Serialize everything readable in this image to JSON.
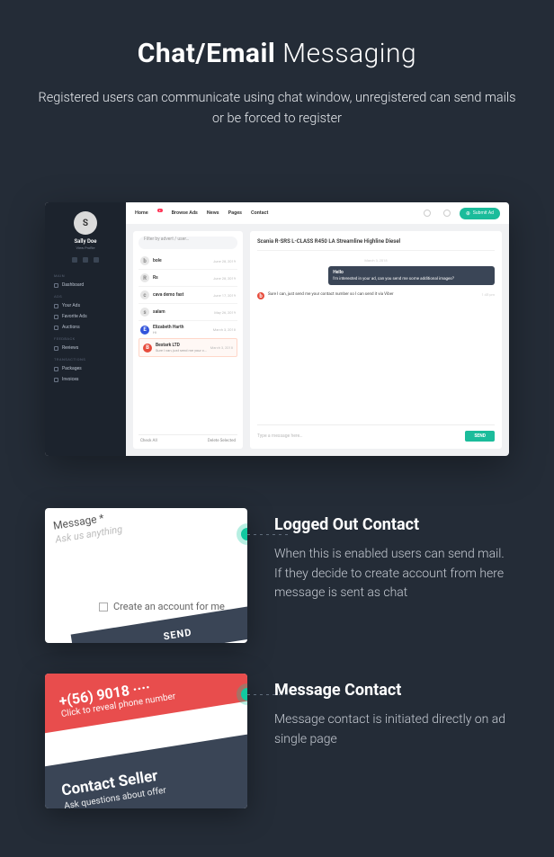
{
  "hero": {
    "title_bold": "Chat/Email",
    "title_rest": " Messaging",
    "subtitle": "Registered users can communicate using chat window, unregistered can send mails or be forced to register"
  },
  "dashboard": {
    "user": {
      "name": "Sally Doe",
      "sub": "View Profile"
    },
    "topnav": {
      "home": "Home",
      "home_badge": "●",
      "browse": "Browse Ads",
      "news": "News",
      "pages": "Pages",
      "contact": "Contact",
      "submit": "Submit Ad"
    },
    "sections": {
      "main": "MAIN",
      "ads": "ADS",
      "feedback": "FEEDBACK",
      "transactions": "TRANSACTIONS"
    },
    "nav": {
      "dashboard": "Dashboard",
      "your_ads": "Your Ads",
      "favorite_ads": "Favorite Ads",
      "auctions": "Auctions",
      "reviews": "Reviews",
      "packages": "Packages",
      "invoices": "Invoices"
    },
    "filter_placeholder": "Filter by advert / user…",
    "conversations": [
      {
        "name": "bole",
        "date": "June 28, 2019",
        "avatar": ""
      },
      {
        "name": "Rs",
        "date": "June 28, 2019",
        "avatar": ""
      },
      {
        "name": "cava demo fast",
        "date": "June 17, 2019",
        "avatar": ""
      },
      {
        "name": "salam",
        "date": "May 26, 2019",
        "avatar": ""
      },
      {
        "name": "Elizabeth Harth",
        "date": "March 3, 2018",
        "avatar": "blue",
        "sub": "Hi"
      },
      {
        "name": "Bestark LTD",
        "date": "March 3, 2018",
        "avatar": "red",
        "sub": "Sure I can, just send me your contact number so I can send it via Viber",
        "highlight": true
      }
    ],
    "conv_footer": {
      "left": "Check All",
      "right": "Delete Selected"
    },
    "chat_title": "Scania R-SRS L-CLASS R450 LA Streamline Highline Diesel",
    "chat": {
      "date": "March 3, 2018",
      "in_hello": "Hello",
      "in_body": "I'm interested in your ad, can you send me some additional images?",
      "out_body": "Sure I can, just send me your contact number so I can send it via Viber",
      "time": "1:45 pm",
      "input_placeholder": "Type a message here…",
      "send": "SEND"
    }
  },
  "features": [
    {
      "title": "Logged Out Contact",
      "body": "When this is enabled users can send mail. If they decide to create account from here message is sent as chat",
      "card": {
        "label": "Message *",
        "placeholder": "Ask us anything",
        "checkbox": "Create an account for me",
        "button": "SEND"
      }
    },
    {
      "title": "Message Contact",
      "body": "Message contact is initiated directly on ad single page",
      "card": {
        "phone": "+(56) 9018 ····",
        "click": "Click to reveal phone number",
        "cs": "Contact Seller",
        "ask": "Ask questions about offer"
      }
    }
  ]
}
